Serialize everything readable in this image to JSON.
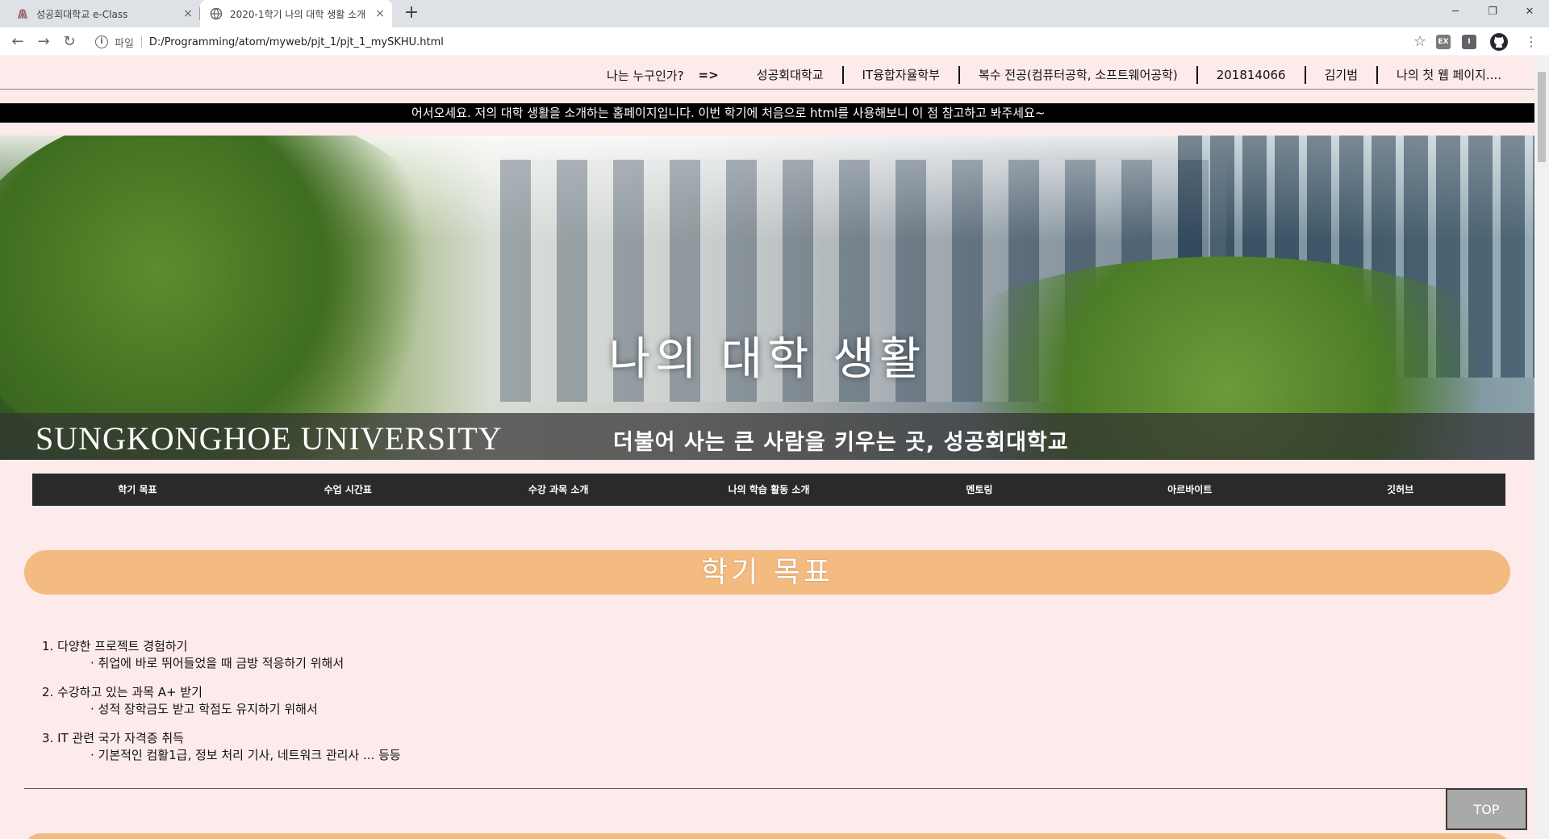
{
  "browser": {
    "tabs": [
      {
        "title": "성공회대학교 e-Class",
        "close": "×"
      },
      {
        "title": "2020-1학기 나의 대학 생활 소개",
        "close": "×"
      }
    ],
    "new_tab": "+",
    "window": {
      "minimize": "─",
      "restore": "❐",
      "close": "✕"
    },
    "nav": {
      "back": "←",
      "forward": "→",
      "reload": "↻"
    },
    "address": {
      "scheme": "파일",
      "url": "D:/Programming/atom/myweb/pjt_1/pjt_1_mySKHU.html",
      "info": "i"
    },
    "star": "☆",
    "extensions": [
      "EX",
      "I"
    ],
    "menu": "⋮",
    "colors": {
      "tabstrip": "#dee1e6",
      "active_tab": "#ffffff"
    }
  },
  "page": {
    "topnav": {
      "who": "나는 누구인가?",
      "arrow": "=>",
      "items": [
        "성공회대학교",
        "IT융합자율학부",
        "복수 전공(컴퓨터공학, 소프트웨어공학)",
        "201814066",
        "김기범",
        "나의 첫 웹 페이지...."
      ]
    },
    "marquee": "어서오세요. 저의 대학 생활을 소개하는 홈페이지입니다. 이번 학기에 처음으로 html를 사용해보니 이 점 참고하고 봐주세요~",
    "hero": {
      "title": "나의 대학 생활",
      "university": "SUNGKONGHOE UNIVERSITY",
      "slogan": "더불어 사는 큰 사람을 키우는 곳, 성공회대학교"
    },
    "menu": [
      "학기 목표",
      "수업 시간표",
      "수강 과목 소개",
      "나의 학습 활동 소개",
      "멘토링",
      "아르바이트",
      "깃허브"
    ],
    "section_title": "학기 목표",
    "goals": [
      {
        "title": "1. 다양한 프로젝트 경험하기",
        "sub": "· 취업에 바로 뛰어들었을 때 금방 적응하기 위해서"
      },
      {
        "title": "2. 수강하고 있는 과목 A+ 받기",
        "sub": "· 성적 장학금도 받고 학점도 유지하기 위해서"
      },
      {
        "title": "3. IT 관련 국가 자격증 취득",
        "sub": "· 기본적인 컴활1급, 정보 처리 기사, 네트워크 관리사 ... 등등"
      }
    ],
    "top_button": "TOP",
    "colors": {
      "background": "#fdeaea",
      "pill": "#f4bb80",
      "menubar": "#2a2a2a",
      "marquee": "#000000"
    }
  }
}
